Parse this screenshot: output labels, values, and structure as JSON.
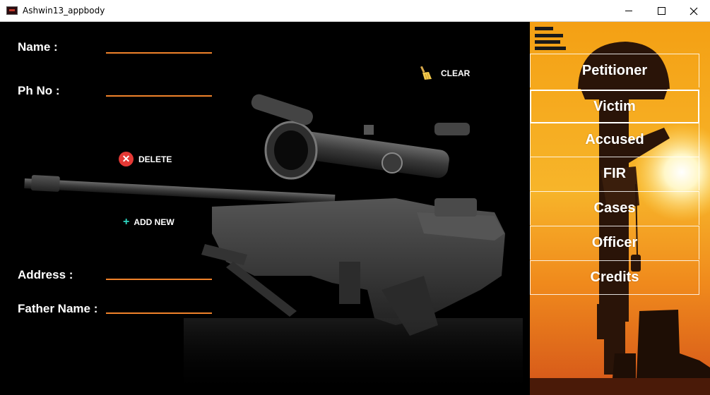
{
  "window": {
    "title": "Ashwin13_appbody"
  },
  "form": {
    "name_label": "Name :",
    "name_value": "",
    "phone_label": "Ph No :",
    "phone_value": "",
    "address_label": "Address :",
    "address_value": "",
    "father_label": "Father Name :",
    "father_value": ""
  },
  "actions": {
    "clear_label": "CLEAR",
    "delete_label": "DELETE",
    "add_label": "ADD NEW",
    "delete_glyph": "✕",
    "add_glyph": "+"
  },
  "sidebar": {
    "items": [
      {
        "label": "Petitioner"
      },
      {
        "label": "Victim"
      },
      {
        "label": "Accused"
      },
      {
        "label": "FIR"
      },
      {
        "label": "Cases"
      },
      {
        "label": "Officer"
      },
      {
        "label": "Credits"
      }
    ]
  },
  "colors": {
    "accent": "#f0822a",
    "delete": "#e53935",
    "add": "#2ed8c3"
  }
}
